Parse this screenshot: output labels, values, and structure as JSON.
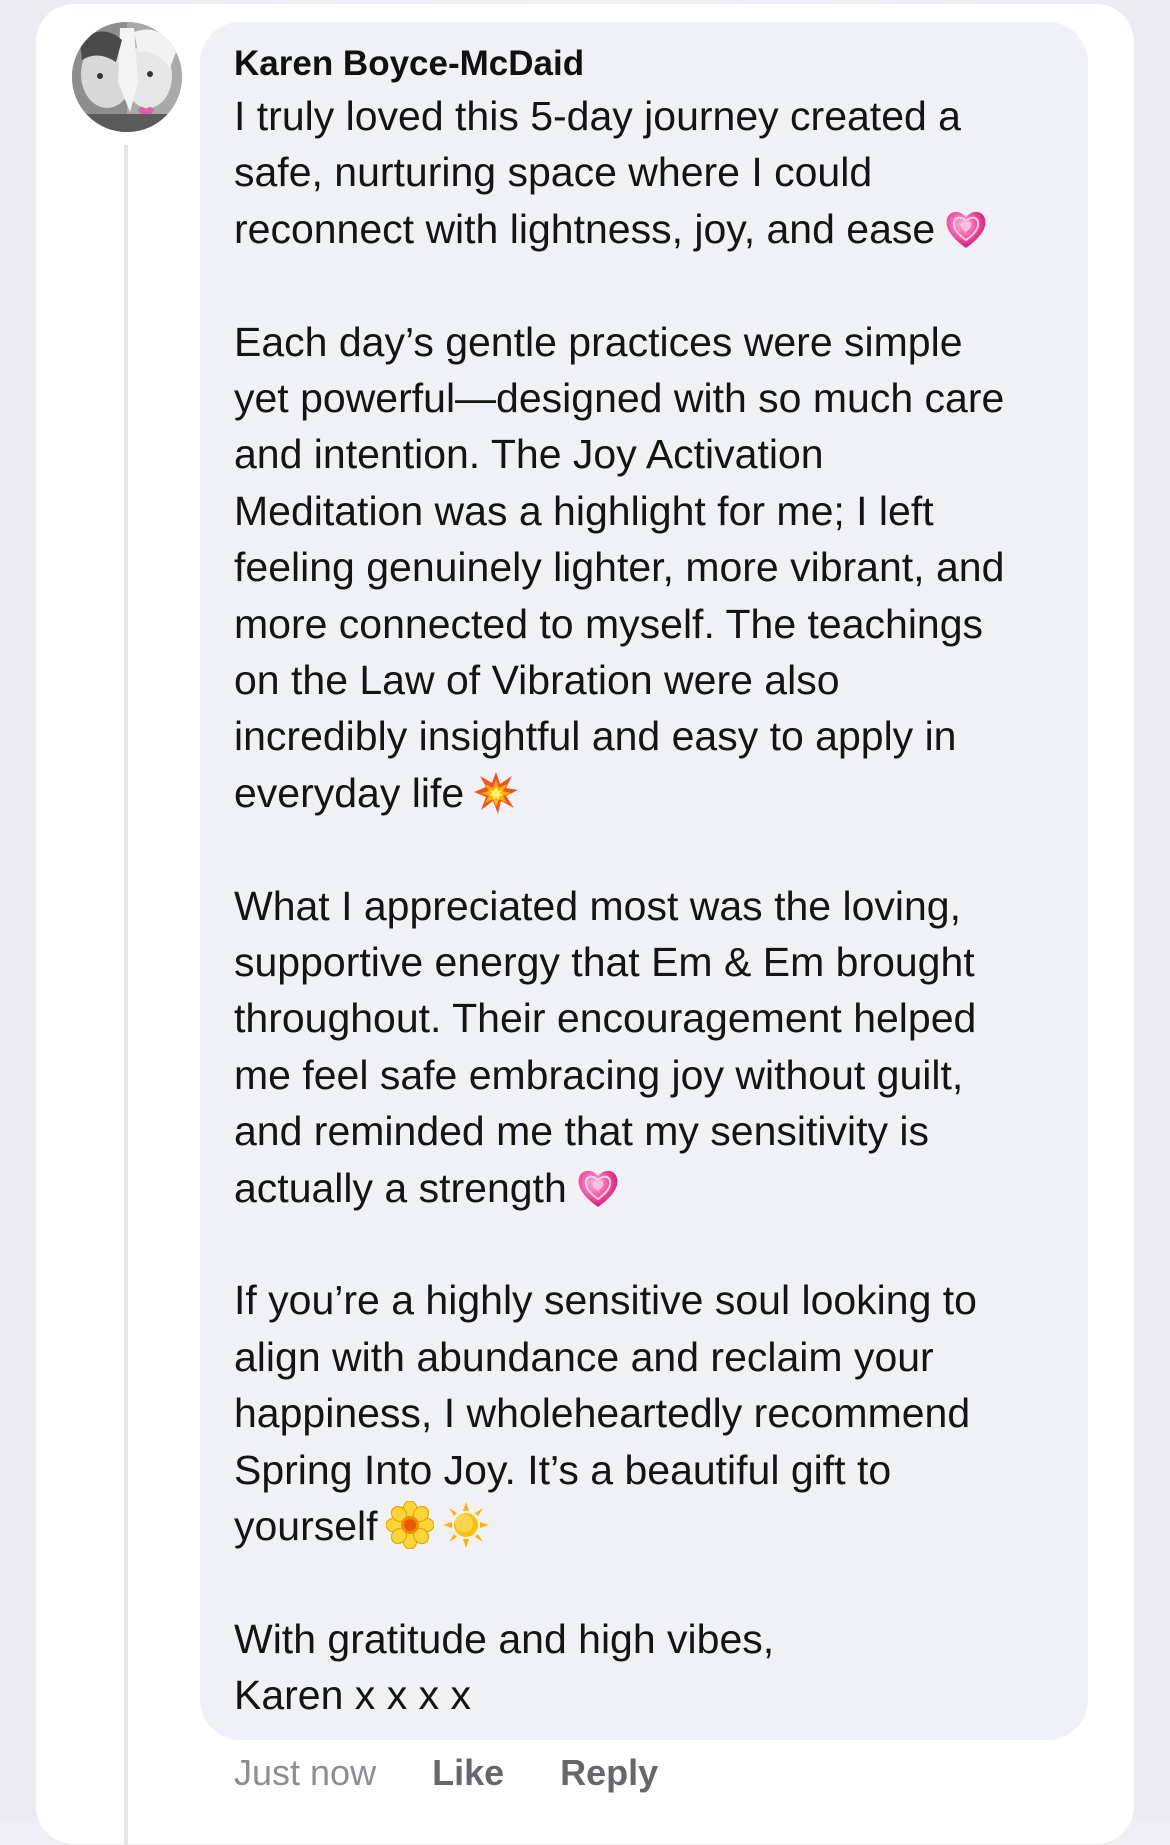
{
  "comment": {
    "author": "Karen Boyce-McDaid",
    "paragraphs": [
      {
        "lines": [
          "I truly loved this 5-day journey created a",
          "safe, nurturing space where I could",
          "reconnect with lightness, joy, and ease"
        ],
        "end_emojis": [
          "growing-heart"
        ]
      },
      {
        "lines": [
          "Each day’s gentle practices were simple",
          "yet powerful—designed with so much care",
          "and intention. The Joy Activation",
          "Meditation was a highlight for me; I left",
          "feeling genuinely lighter, more vibrant, and",
          "more connected to myself. The teachings",
          "on the Law of Vibration were also",
          "incredibly insightful and easy to apply in",
          "everyday life"
        ],
        "end_emojis": [
          "collision"
        ]
      },
      {
        "lines": [
          "What I appreciated most was the loving,",
          "supportive energy that Em & Em brought",
          "throughout. Their encouragement helped",
          "me feel safe embracing joy without guilt,",
          "and reminded me that my sensitivity is",
          "actually a strength"
        ],
        "end_emojis": [
          "growing-heart"
        ]
      },
      {
        "lines": [
          "If you’re a highly sensitive soul looking to",
          "align with abundance and reclaim your",
          "happiness, I wholeheartedly recommend",
          "Spring Into Joy. It’s a beautiful gift to",
          "yourself"
        ],
        "end_emojis": [
          "blossom",
          "sun"
        ]
      },
      {
        "lines": [
          "With gratitude and high vibes,",
          "Karen x x x x"
        ],
        "end_emojis": []
      }
    ],
    "timestamp": "Just now",
    "like_label": "Like",
    "reply_label": "Reply"
  },
  "colors": {
    "bubble": "#f0f1f6",
    "card": "#ffffff",
    "text": "#141414",
    "meta": "#8a8d91",
    "action": "#65676b"
  }
}
